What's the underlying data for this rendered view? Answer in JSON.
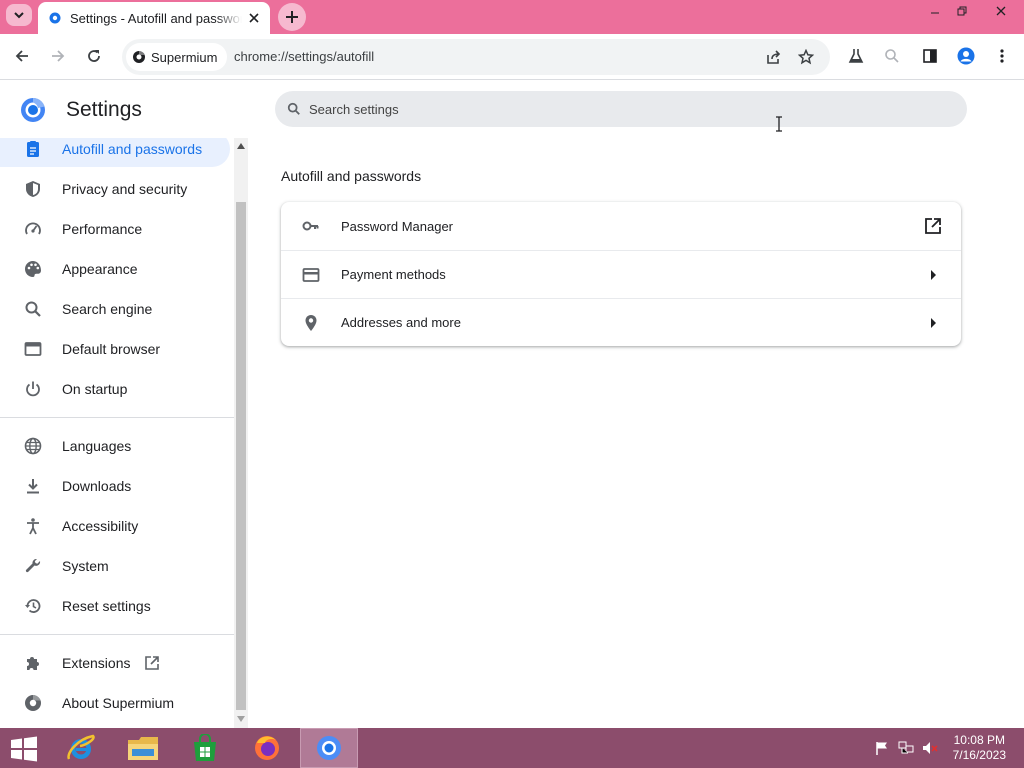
{
  "browser": {
    "tab_title": "Settings - Autofill and passwords",
    "site_chip": "Supermium",
    "url": "chrome://settings/autofill"
  },
  "settings": {
    "title": "Settings",
    "search_placeholder": "Search settings"
  },
  "sidebar": {
    "items": [
      {
        "label": "Autofill and passwords",
        "icon": "clipboard-icon",
        "active": true
      },
      {
        "label": "Privacy and security",
        "icon": "shield-icon"
      },
      {
        "label": "Performance",
        "icon": "speedometer-icon"
      },
      {
        "label": "Appearance",
        "icon": "palette-icon"
      },
      {
        "label": "Search engine",
        "icon": "search-icon"
      },
      {
        "label": "Default browser",
        "icon": "browser-window-icon"
      },
      {
        "label": "On startup",
        "icon": "power-icon"
      },
      {
        "label": "Languages",
        "icon": "globe-icon"
      },
      {
        "label": "Downloads",
        "icon": "download-icon"
      },
      {
        "label": "Accessibility",
        "icon": "accessibility-icon"
      },
      {
        "label": "System",
        "icon": "wrench-icon"
      },
      {
        "label": "Reset settings",
        "icon": "history-icon"
      },
      {
        "label": "Extensions",
        "icon": "puzzle-icon"
      },
      {
        "label": "About Supermium",
        "icon": "supermium-logo-icon"
      }
    ]
  },
  "main": {
    "section_title": "Autofill and passwords",
    "rows": [
      {
        "label": "Password Manager",
        "icon": "key-icon",
        "end_icon": "open-in-new-icon"
      },
      {
        "label": "Payment methods",
        "icon": "credit-card-icon",
        "end_icon": "arrow-right-icon"
      },
      {
        "label": "Addresses and more",
        "icon": "location-pin-icon",
        "end_icon": "arrow-right-icon"
      }
    ]
  },
  "taskbar": {
    "apps": [
      "internet-explorer",
      "file-explorer",
      "store",
      "firefox",
      "supermium"
    ],
    "time": "10:08 PM",
    "date": "7/16/2023"
  },
  "colors": {
    "titlebar": "#ec6f9b",
    "accent": "#1a73e8",
    "taskbar": "#8c4d6c"
  }
}
